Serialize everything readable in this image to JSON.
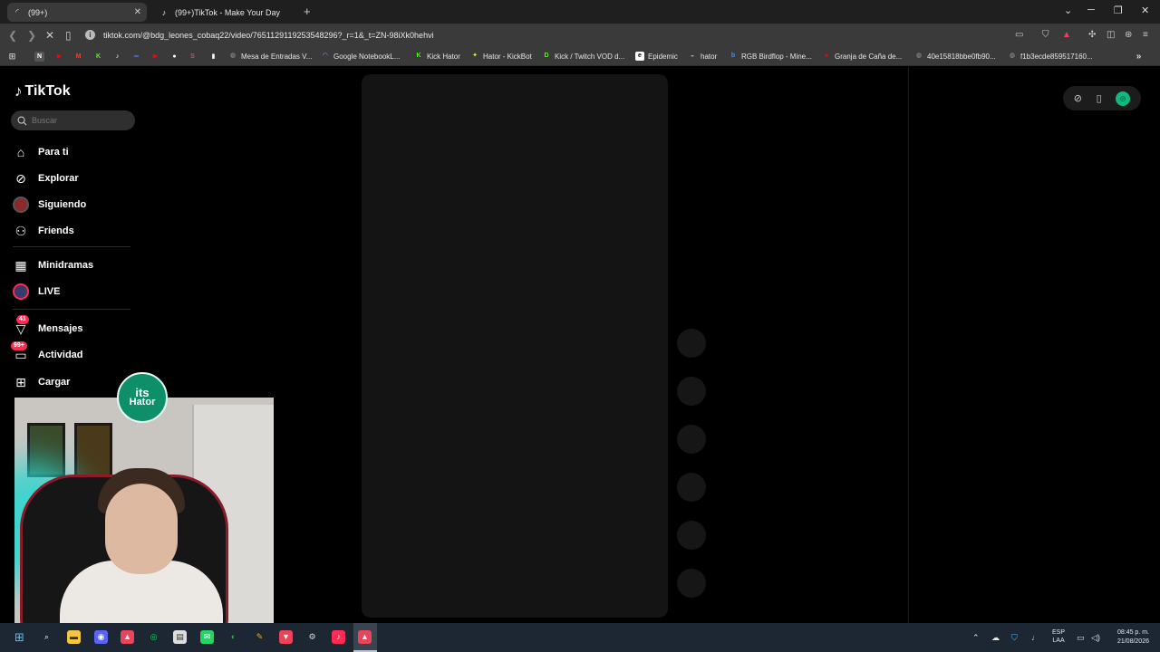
{
  "browser": {
    "tabs": [
      {
        "title": "(99+)",
        "icon": "spinner-icon",
        "active": true
      },
      {
        "title": "(99+)TikTok - Make Your Day",
        "icon": "tiktok-icon",
        "active": false
      }
    ],
    "new_tab": "+",
    "url": "tiktok.com/@bdg_leones_cobaq22/video/7651129119253548296?_r=1&_t=ZN-98iXk0hehvi",
    "bookmarks": [
      {
        "label": "Mesa de Entradas V...",
        "icon": "globe-icon",
        "color": "#9aa0a6"
      },
      {
        "label": "Google NotebookL...",
        "icon": "notebook-icon",
        "color": "#8ab4f8"
      },
      {
        "label": "Kick Hator",
        "icon": "kick-icon",
        "color": "#53fc18"
      },
      {
        "label": "Hator - KickBot",
        "icon": "kickbot-icon",
        "color": "#d6f53a"
      },
      {
        "label": "Kick / Twitch VOD d...",
        "icon": "vod-icon",
        "color": "#53fc18"
      },
      {
        "label": "Epidemic",
        "icon": "epidemic-icon",
        "color": "#ffffff"
      },
      {
        "label": "hator",
        "icon": "hator-icon",
        "color": "#8ab4f8"
      },
      {
        "label": "RGB Birdflop - Mine...",
        "icon": "birdflop-icon",
        "color": "#4c8bf5"
      },
      {
        "label": "Granja de Caña de...",
        "icon": "youtube-icon",
        "color": "#ff0000"
      },
      {
        "label": "40e15818bbe0fb90...",
        "icon": "globe-icon",
        "color": "#9aa0a6"
      },
      {
        "label": "f1b3ecde859517160...",
        "icon": "globe-icon",
        "color": "#9aa0a6"
      }
    ]
  },
  "tiktok": {
    "brand": "TikTok",
    "search_placeholder": "Buscar",
    "nav": [
      {
        "label": "Para ti",
        "icon": "home-icon"
      },
      {
        "label": "Explorar",
        "icon": "compass-icon"
      },
      {
        "label": "Siguiendo",
        "icon": "following-avatar-icon"
      },
      {
        "label": "Friends",
        "icon": "friends-icon"
      },
      {
        "label": "Minidramas",
        "icon": "minidramas-icon"
      },
      {
        "label": "LIVE",
        "icon": "live-icon"
      },
      {
        "label": "Mensajes",
        "icon": "messages-icon",
        "badge": "41"
      },
      {
        "label": "Actividad",
        "icon": "activity-icon",
        "badge": "99+"
      },
      {
        "label": "Cargar",
        "icon": "upload-icon"
      }
    ]
  },
  "webcam": {
    "logo_line1": "its",
    "logo_line2": "Hator"
  },
  "taskbar": {
    "lang_line1": "ESP",
    "lang_line2": "LAA",
    "time": "08:45 p. m.",
    "date": "21/08/2026"
  },
  "colors": {
    "accent": "#fe2c55",
    "live_ring": "#fe2c55"
  }
}
